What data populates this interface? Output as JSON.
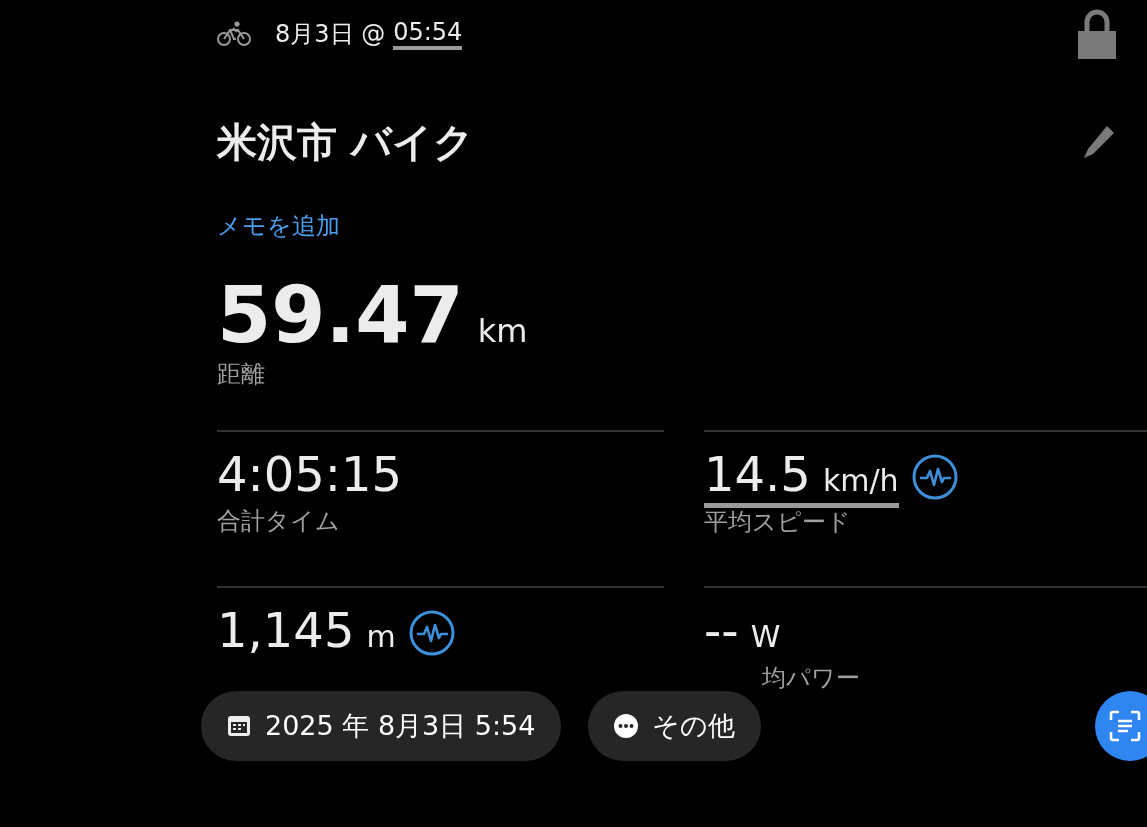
{
  "header": {
    "date": "8月3日 @",
    "time": "05:54"
  },
  "title": "米沢市 バイク",
  "add_note_link": "メモを追加",
  "distance": {
    "value": "59.47",
    "unit": "km",
    "label": "距離"
  },
  "stats": [
    {
      "value": "4:05:15",
      "label": "合計タイム",
      "underlined": false,
      "chart_icon": false
    },
    {
      "value": "14.5",
      "unit": "km/h",
      "label": "平均スピード",
      "underlined": true,
      "chart_icon": true
    },
    {
      "value": "1,145",
      "unit": "m",
      "underlined": false,
      "chart_icon": true
    },
    {
      "value": "--",
      "unit": "W",
      "label": "均パワー",
      "underlined": false,
      "chart_icon": false
    }
  ],
  "date_pill": "2025 年 8月3日 5:54",
  "more_pill": "その他"
}
